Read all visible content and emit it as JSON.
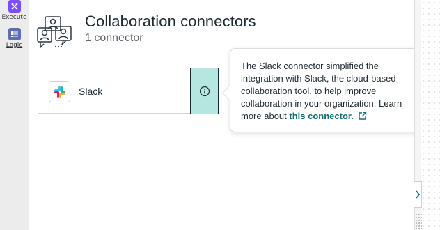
{
  "rail": {
    "items": [
      {
        "label": "Execute",
        "icon": "execute-icon",
        "color": "#7c4dff"
      },
      {
        "label": "Logic",
        "icon": "logic-icon",
        "color": "#5b6fb5"
      }
    ]
  },
  "header": {
    "title": "Collaboration connectors",
    "subtitle": "1 connector",
    "icon": "people-group-icon"
  },
  "connectors": [
    {
      "name": "Slack",
      "icon": "slack-logo"
    }
  ],
  "tooltip": {
    "text": "The Slack connector simplified the integration with Slack, the cloud-based collaboration tool, to help improve collaboration in your organization. Learn more about ",
    "link_text": "this connector.",
    "link_icon": "external-link-icon"
  },
  "colors": {
    "accent": "#0f6e73",
    "info_button_bg": "#b6e6e0"
  }
}
